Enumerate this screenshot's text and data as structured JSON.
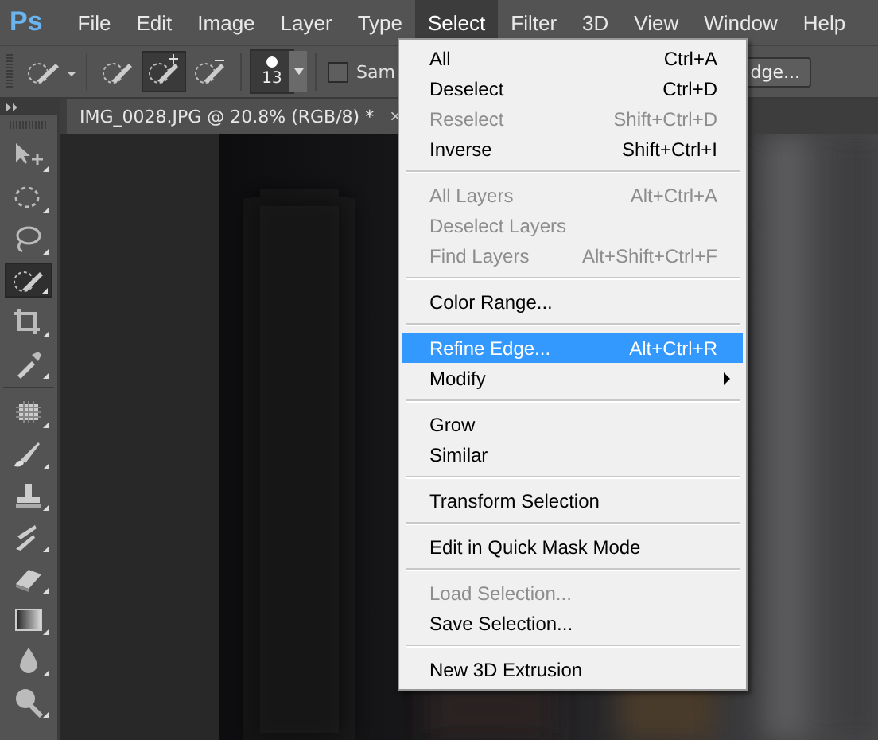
{
  "app": {
    "logo": "Ps"
  },
  "menubar": [
    {
      "label": "File",
      "selected": false
    },
    {
      "label": "Edit",
      "selected": false
    },
    {
      "label": "Image",
      "selected": false
    },
    {
      "label": "Layer",
      "selected": false
    },
    {
      "label": "Type",
      "selected": false
    },
    {
      "label": "Select",
      "selected": true
    },
    {
      "label": "Filter",
      "selected": false
    },
    {
      "label": "3D",
      "selected": false
    },
    {
      "label": "View",
      "selected": false
    },
    {
      "label": "Window",
      "selected": false
    },
    {
      "label": "Help",
      "selected": false
    }
  ],
  "options_bar": {
    "modes": [
      {
        "kind": "new",
        "selected": false
      },
      {
        "kind": "add",
        "selected": true
      },
      {
        "kind": "subtract",
        "selected": false
      }
    ],
    "brush_size": "13",
    "sample_checkbox": {
      "label": "Sam",
      "checked": false
    },
    "refine_button": "dge..."
  },
  "document_tab": {
    "title": "IMG_0028.JPG @ 20.8% (RGB/8) *",
    "close": "×"
  },
  "toolbox": [
    {
      "kind": "move",
      "selected": false
    },
    {
      "kind": "marquee",
      "selected": false
    },
    {
      "kind": "lasso",
      "selected": false
    },
    {
      "kind": "quick-select",
      "selected": true
    },
    {
      "kind": "crop",
      "selected": false
    },
    {
      "kind": "eyedropper",
      "selected": false
    },
    {
      "kind": "healing",
      "selected": false
    },
    {
      "kind": "brush",
      "selected": false
    },
    {
      "kind": "stamp",
      "selected": false
    },
    {
      "kind": "history-brush",
      "selected": false
    },
    {
      "kind": "eraser",
      "selected": false
    },
    {
      "kind": "gradient",
      "selected": false
    },
    {
      "kind": "blur",
      "selected": false
    },
    {
      "kind": "dodge",
      "selected": false
    }
  ],
  "select_menu": {
    "groups": [
      {
        "items": [
          {
            "label": "All",
            "shortcut": "Ctrl+A",
            "disabled": false,
            "selected": false,
            "submenu": false
          },
          {
            "label": "Deselect",
            "shortcut": "Ctrl+D",
            "disabled": false,
            "selected": false,
            "submenu": false
          },
          {
            "label": "Reselect",
            "shortcut": "Shift+Ctrl+D",
            "disabled": true,
            "selected": false,
            "submenu": false
          },
          {
            "label": "Inverse",
            "shortcut": "Shift+Ctrl+I",
            "disabled": false,
            "selected": false,
            "submenu": false
          }
        ]
      },
      {
        "items": [
          {
            "label": "All Layers",
            "shortcut": "Alt+Ctrl+A",
            "disabled": true,
            "selected": false,
            "submenu": false
          },
          {
            "label": "Deselect Layers",
            "disabled": true,
            "selected": false,
            "submenu": false
          },
          {
            "label": "Find Layers",
            "shortcut": "Alt+Shift+Ctrl+F",
            "disabled": true,
            "selected": false,
            "submenu": false
          }
        ]
      },
      {
        "items": [
          {
            "label": "Color Range...",
            "disabled": false,
            "selected": false,
            "submenu": false
          }
        ]
      },
      {
        "items": [
          {
            "label": "Refine Edge...",
            "shortcut": "Alt+Ctrl+R",
            "disabled": false,
            "selected": true,
            "submenu": false
          },
          {
            "label": "Modify",
            "disabled": false,
            "selected": false,
            "submenu": true
          }
        ]
      },
      {
        "items": [
          {
            "label": "Grow",
            "disabled": false,
            "selected": false,
            "submenu": false
          },
          {
            "label": "Similar",
            "disabled": false,
            "selected": false,
            "submenu": false
          }
        ]
      },
      {
        "items": [
          {
            "label": "Transform Selection",
            "disabled": false,
            "selected": false,
            "submenu": false
          }
        ]
      },
      {
        "items": [
          {
            "label": "Edit in Quick Mask Mode",
            "disabled": false,
            "selected": false,
            "submenu": false
          }
        ]
      },
      {
        "items": [
          {
            "label": "Load Selection...",
            "disabled": true,
            "selected": false,
            "submenu": false
          },
          {
            "label": "Save Selection...",
            "disabled": false,
            "selected": false,
            "submenu": false
          }
        ]
      },
      {
        "items": [
          {
            "label": "New 3D Extrusion",
            "disabled": false,
            "selected": false,
            "submenu": false
          }
        ]
      }
    ]
  }
}
